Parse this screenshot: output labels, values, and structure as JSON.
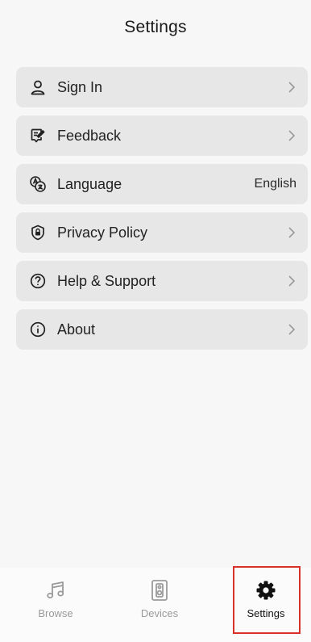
{
  "header": {
    "title": "Settings"
  },
  "menu": {
    "items": [
      {
        "label": "Sign In",
        "icon": "person-icon",
        "value": ""
      },
      {
        "label": "Feedback",
        "icon": "feedback-icon",
        "value": ""
      },
      {
        "label": "Language",
        "icon": "language-icon",
        "value": "English"
      },
      {
        "label": "Privacy Policy",
        "icon": "shield-lock-icon",
        "value": ""
      },
      {
        "label": "Help & Support",
        "icon": "question-circle-icon",
        "value": ""
      },
      {
        "label": "About",
        "icon": "info-circle-icon",
        "value": ""
      }
    ]
  },
  "tabbar": {
    "tabs": [
      {
        "label": "Browse",
        "icon": "music-note-icon",
        "active": false
      },
      {
        "label": "Devices",
        "icon": "speaker-icon",
        "active": false
      },
      {
        "label": "Settings",
        "icon": "gear-icon",
        "active": true
      }
    ],
    "active_highlight_color": "#d9302a"
  },
  "colors": {
    "background": "#f7f7f7",
    "row_background": "#e7e7e7",
    "inactive_tab": "#9a9a9a"
  }
}
